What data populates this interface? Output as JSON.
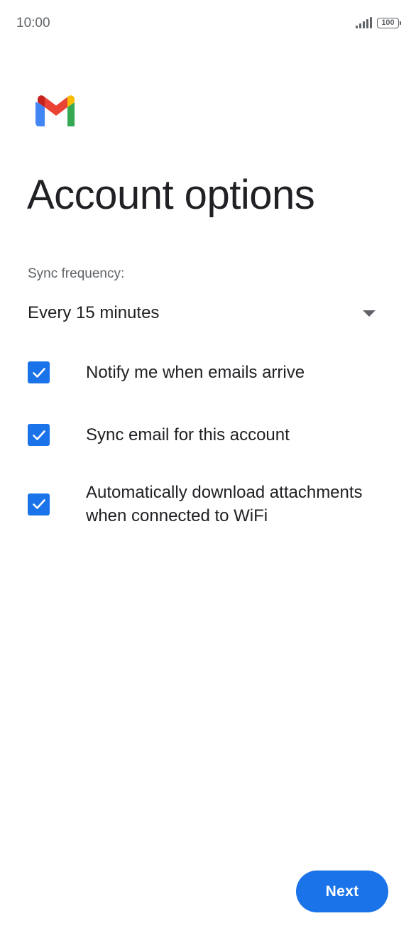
{
  "status_bar": {
    "time": "10:00",
    "battery": "100",
    "signal_icon": "signal-bars-icon",
    "battery_icon": "battery-icon"
  },
  "app_logo": "gmail-logo",
  "title": "Account options",
  "sync": {
    "label": "Sync frequency:",
    "selected": "Every 15 minutes",
    "icon": "dropdown-arrow-icon"
  },
  "options": [
    {
      "label": "Notify me when emails arrive",
      "checked": true
    },
    {
      "label": "Sync email for this account",
      "checked": true
    },
    {
      "label": "Automatically download attachments when connected to WiFi",
      "checked": true
    }
  ],
  "next_button": {
    "label": "Next"
  },
  "colors": {
    "accent": "#1a73e8",
    "text_primary": "#202124",
    "text_secondary": "#5f6368",
    "background": "#ffffff"
  }
}
